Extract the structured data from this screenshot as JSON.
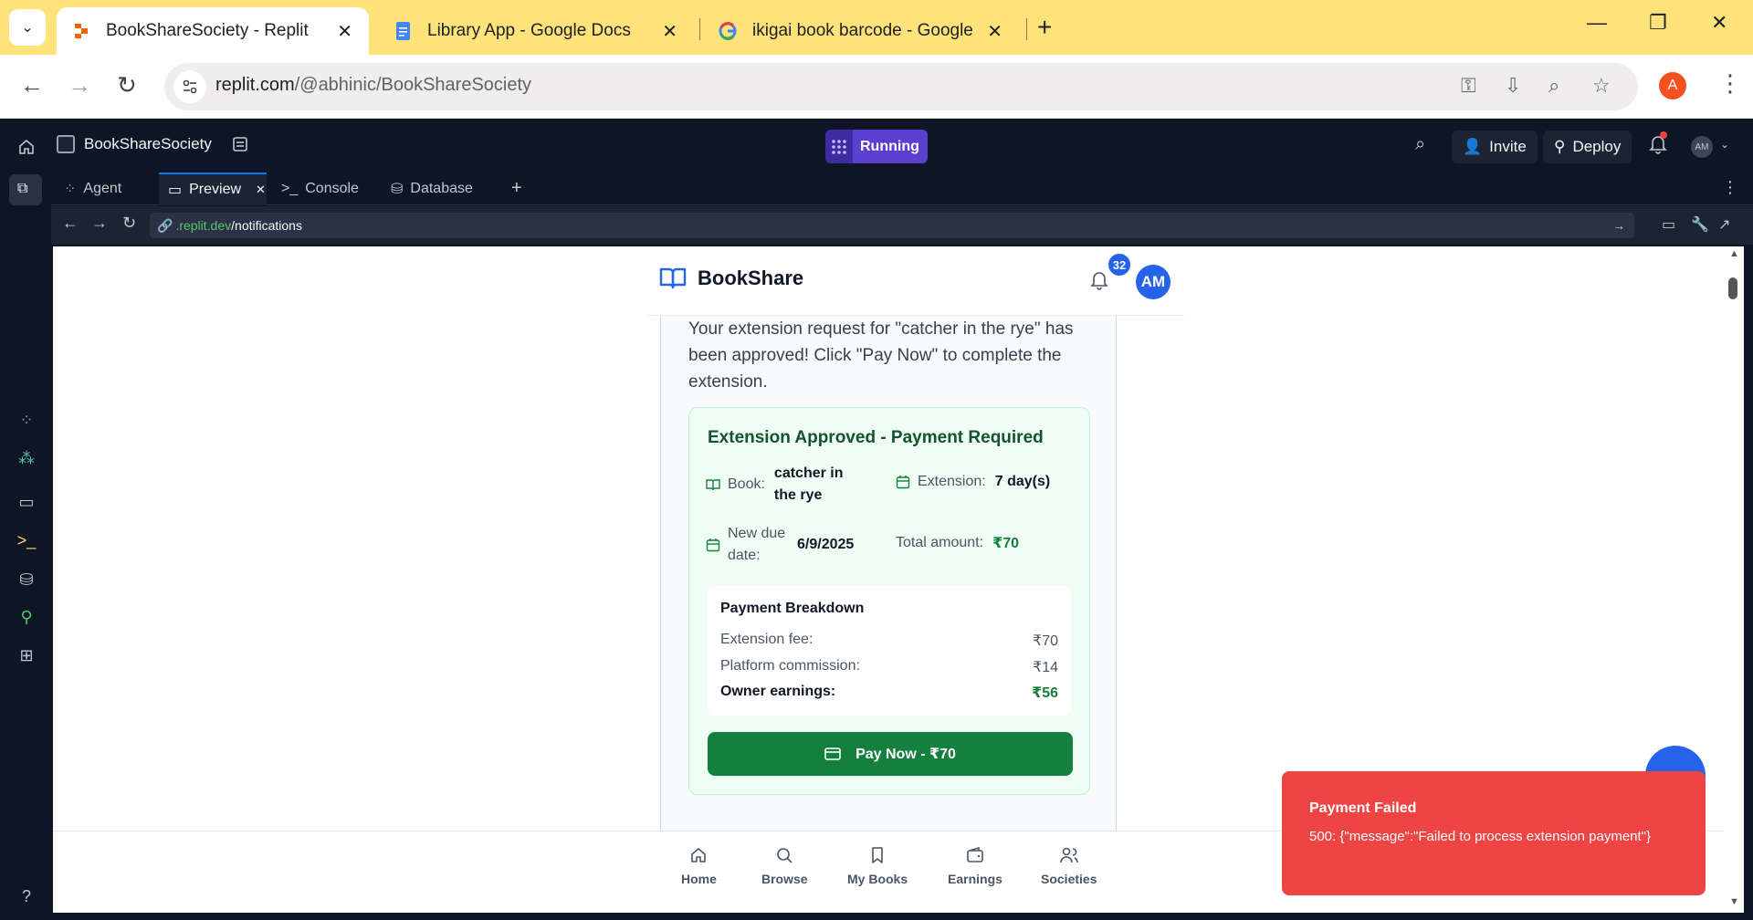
{
  "browser": {
    "tabs": [
      {
        "title": "BookShareSociety - Replit",
        "active": true
      },
      {
        "title": "Library App - Google Docs",
        "active": false
      },
      {
        "title": "ikigai book barcode - Google Se",
        "active": false
      }
    ],
    "url_host": "replit.com",
    "url_path": "/@abhinic/BookShareSociety",
    "profile_initial": "A"
  },
  "replit": {
    "project_name": "BookShareSociety",
    "run_status": "Running",
    "invite_label": "Invite",
    "deploy_label": "Deploy",
    "user_initials": "AM",
    "workspace_tabs": [
      "Agent",
      "Preview",
      "Console",
      "Database"
    ],
    "preview_url_domain": ".replit.dev",
    "preview_url_path": "/notifications"
  },
  "app": {
    "brand": "BookShare",
    "notification_count": "32",
    "user_initials": "AM",
    "message": "Your extension request for \"catcher in the rye\" has been approved! Click \"Pay Now\" to complete the extension.",
    "extension": {
      "title": "Extension Approved - Payment Required",
      "book_label": "Book:",
      "book_value": "catcher in the rye",
      "extension_label": "Extension:",
      "extension_value": "7 day(s)",
      "due_label": "New due date:",
      "due_value": "6/9/2025",
      "total_label": "Total amount:",
      "total_value": "₹70"
    },
    "breakdown": {
      "title": "Payment Breakdown",
      "rows": [
        {
          "label": "Extension fee:",
          "value": "₹70"
        },
        {
          "label": "Platform commission:",
          "value": "₹14"
        },
        {
          "label": "Owner earnings:",
          "value": "₹56"
        }
      ]
    },
    "pay_button": "Pay Now - ₹70",
    "bottom_nav": [
      "Home",
      "Browse",
      "My Books",
      "Earnings",
      "Societies"
    ]
  },
  "toast": {
    "title": "Payment Failed",
    "body": "500: {\"message\":\"Failed to process extension payment\"}"
  },
  "colors": {
    "chrome_tabstrip": "#fde37a",
    "replit_bg": "#0e1525",
    "running": "#5b3fd1",
    "primary_blue": "#2563eb",
    "pay_green": "#15803d",
    "toast_red": "#ef4444"
  }
}
